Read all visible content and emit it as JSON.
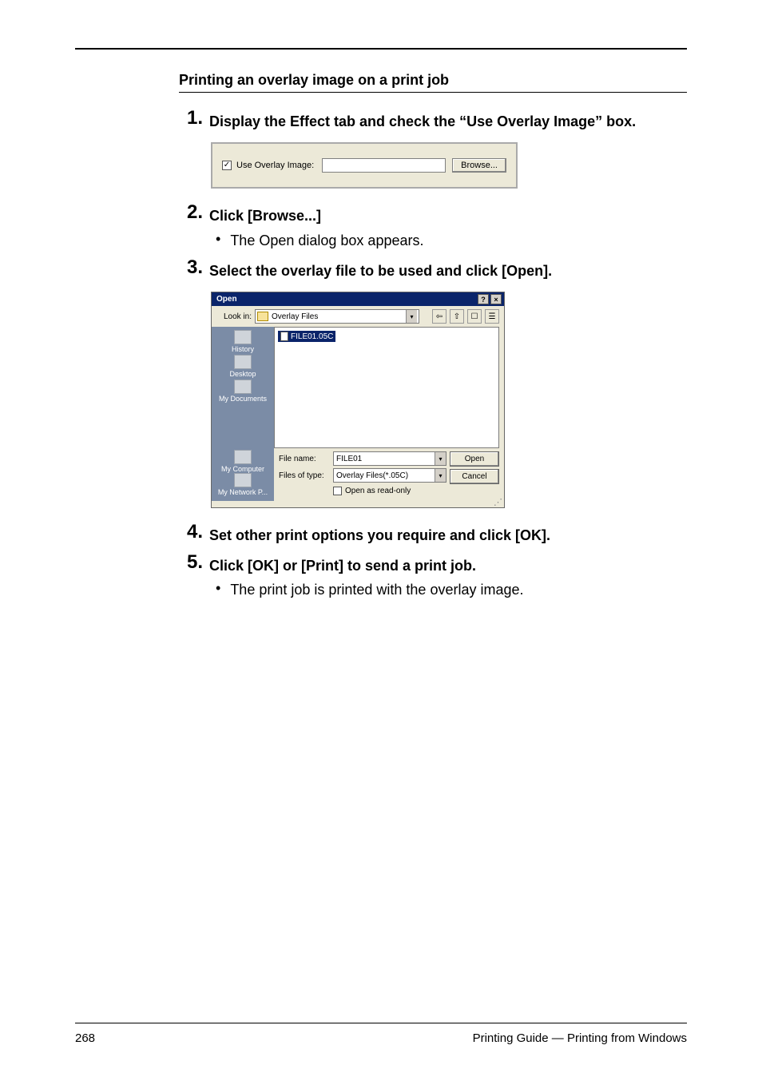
{
  "section_title": "Printing an overlay image on a print job",
  "steps": [
    {
      "num": "1",
      "text": "Display the Effect tab and check the “Use Overlay Image” box.",
      "bullets": []
    },
    {
      "num": "2",
      "text": "Click [Browse...]",
      "bullets": [
        "The Open dialog box appears."
      ]
    },
    {
      "num": "3",
      "text": "Select the overlay file to be used and click [Open].",
      "bullets": []
    },
    {
      "num": "4",
      "text": "Set other print options you require and click [OK].",
      "bullets": []
    },
    {
      "num": "5",
      "text": "Click [OK] or [Print] to send a print job.",
      "bullets": [
        "The print job is printed with the overlay image."
      ]
    }
  ],
  "fig1": {
    "checkbox_checked": "✓",
    "checkbox_label": "Use Overlay Image:",
    "textbox_value": "",
    "browse_label": "Browse..."
  },
  "fig2": {
    "title": "Open",
    "help_btn": "?",
    "close_btn": "×",
    "lookin_label": "Look in:",
    "lookin_value": "Overlay Files",
    "tool_back": "⇦",
    "tool_up": "⇧",
    "tool_new": "☐",
    "tool_view": "☰",
    "places": [
      "History",
      "Desktop",
      "My Documents",
      "My Computer",
      "My Network P..."
    ],
    "selected_file": "FILE01.05C",
    "filename_label": "File name:",
    "filename_value": "FILE01",
    "filetype_label": "Files of type:",
    "filetype_value": "Overlay Files(*.05C)",
    "readonly_label": "Open as read-only",
    "open_btn": "Open",
    "cancel_btn": "Cancel",
    "drop_glyph": "▾"
  },
  "footer": {
    "page": "268",
    "text": "Printing Guide — Printing from Windows"
  }
}
